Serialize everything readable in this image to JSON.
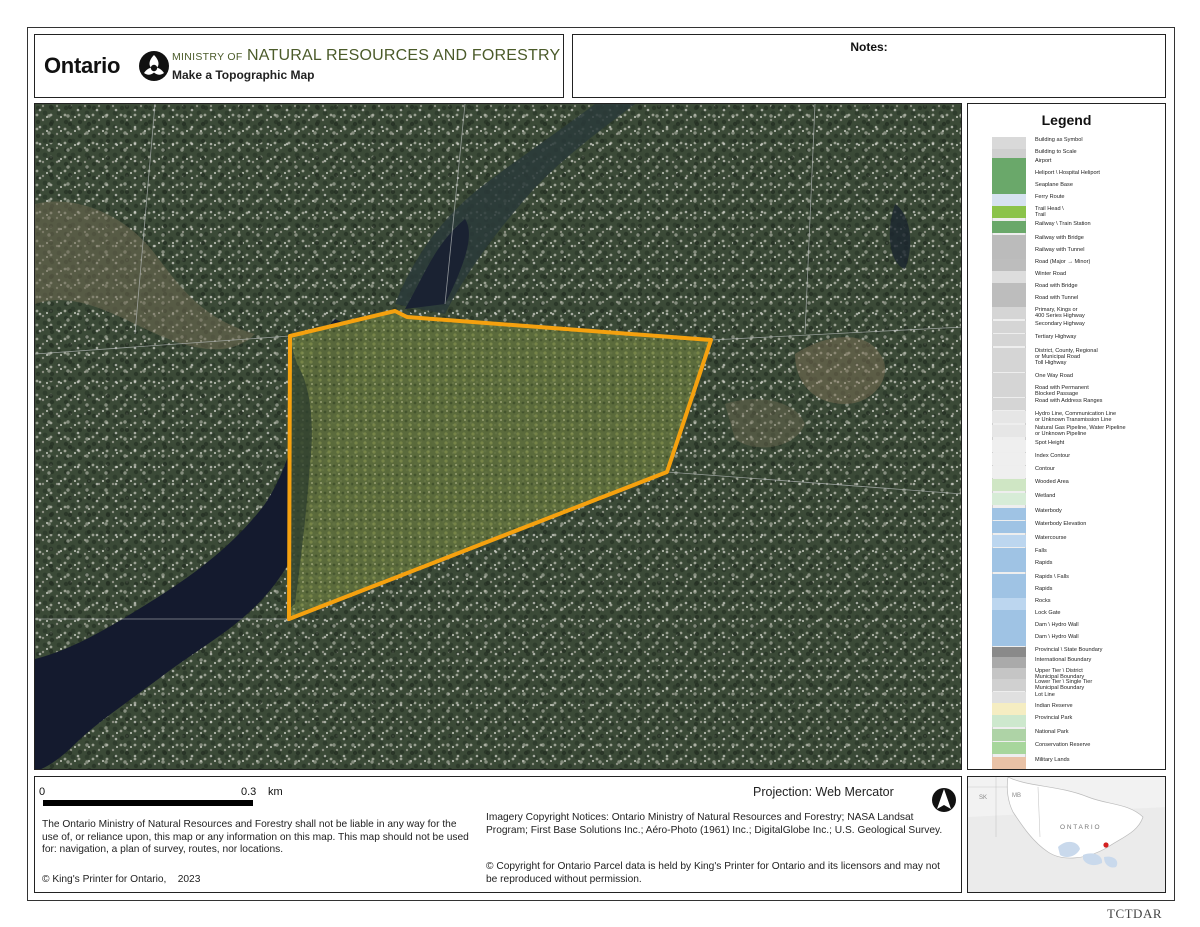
{
  "header": {
    "brand": "Ontario",
    "ministry_prefix": "MINISTRY OF",
    "ministry_name": "NATURAL RESOURCES AND FORESTRY",
    "subtitle": "Make a Topographic Map"
  },
  "notes": {
    "label": "Notes:"
  },
  "legend": {
    "title": "Legend",
    "items": [
      "Building as Symbol",
      "Building to Scale",
      "Airport",
      "Heliport \\ Hospital Heliport",
      "Seaplane Base",
      "Ferry Route",
      "Trail Head \\\nTrail",
      "Railway \\ Train Station",
      "Railway with Bridge",
      "Railway with Tunnel",
      "Road (Major → Minor)",
      "Winter Road",
      "Road with Bridge",
      "Road with Tunnel",
      "Primary, Kings or\n400 Series Highway",
      "Secondary Highway",
      "Tertiary Highway",
      "District, County, Regional\nor Municipal Road",
      "Toll Highway",
      "One Way Road",
      "Road with Permanent\nBlocked Passage",
      "Road with Address Ranges",
      "Hydro Line, Communication Line\nor Unknown Transmission Line",
      "Natural Gas Pipeline, Water Pipeline\nor Unknown Pipeline",
      "Spot Height",
      "Index Contour",
      "Contour",
      "Wooded Area",
      "Wetland",
      "Waterbody",
      "Waterbody Elevation",
      "Watercourse",
      "Falls",
      "Rapids",
      "Rapids \\ Falls",
      "Rapids",
      "Rocks",
      "Lock Gate",
      "Dam \\ Hydro Wall",
      "Dam \\ Hydro Wall",
      "Provincial \\ State Boundary",
      "International Boundary",
      "Upper Tier \\ District\nMunicipal Boundary",
      "Lower Tier \\ Single Tier\nMunicipal Boundary",
      "Lot Line",
      "Indian Reserve",
      "Provincial Park",
      "National Park",
      "Conservation Reserve",
      "Military Lands"
    ]
  },
  "footer": {
    "scale_start": "0",
    "scale_end": "0.3",
    "scale_unit": "km",
    "disclaimer": "The Ontario Ministry of Natural Resources and Forestry shall not be liable in any way for the use of, or reliance upon, this map or any information on this map.  This map should not be used for: navigation, a plan of survey, routes, nor locations.",
    "kings_printer": "© King's Printer for Ontario,    2023",
    "projection": "Projection: Web Mercator",
    "imagery_notice": "Imagery Copyright Notices: Ontario Ministry of Natural Resources and Forestry; NASA Landsat Program; First Base Solutions Inc.; Aéro-Photo (1961) Inc.; DigitalGlobe Inc.; U.S. Geological Survey.",
    "parcel_notice": "© Copyright for Ontario Parcel data is held by King's Printer for Ontario and its licensors and may not be reproduced without permission."
  },
  "inset": {
    "labels": [
      "SK",
      "MB",
      "O N T A R I O"
    ]
  },
  "colors": {
    "parcel_outline": "#f5a10f",
    "ministry_text": "#4b5b2a",
    "forest": "#3a4a36",
    "water": "#141a2e"
  },
  "watermark": "TCTDAR"
}
